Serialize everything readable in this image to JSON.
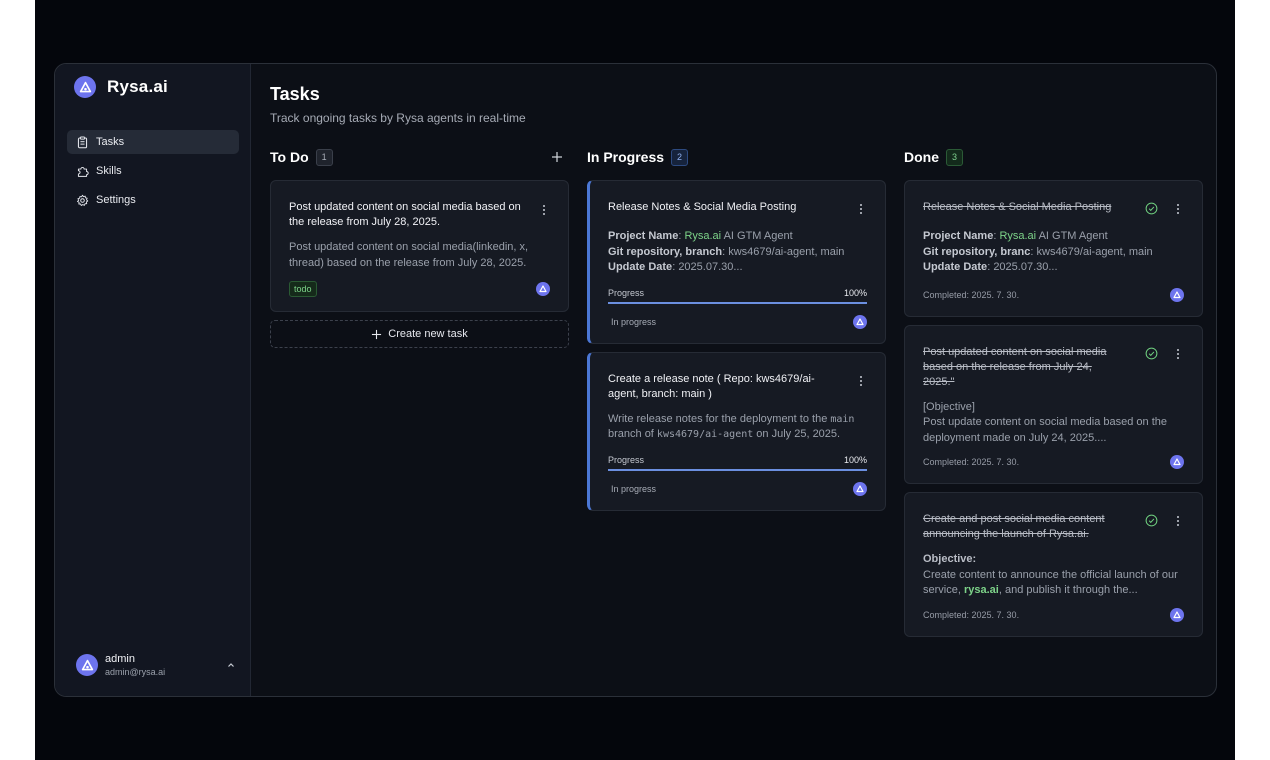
{
  "app": {
    "brand": "Rysa.ai",
    "accent": "#6d74ee"
  },
  "sidebar": {
    "items": [
      {
        "label": "Tasks",
        "icon": "clipboard-icon",
        "active": true
      },
      {
        "label": "Skills",
        "icon": "puzzle-icon",
        "active": false
      },
      {
        "label": "Settings",
        "icon": "gear-icon",
        "active": false
      }
    ],
    "user": {
      "name": "admin",
      "email": "admin@rysa.ai"
    }
  },
  "header": {
    "title": "Tasks",
    "subtitle": "Track ongoing tasks by Rysa agents in real-time"
  },
  "columns": {
    "todo": {
      "title": "To Do",
      "count": "1",
      "create_label": "Create new task",
      "cards": [
        {
          "title": "Post updated content on social media based on the release from July 28, 2025.",
          "desc": "Post updated content on social media(linkedin, x, thread) based on the release from July 28, 2025.",
          "tag": "todo"
        }
      ]
    },
    "progress": {
      "title": "In Progress",
      "count": "2",
      "cards": [
        {
          "title": "Release Notes & Social Media Posting",
          "project_label": "Project Name",
          "project_value_green": "Rysa.ai",
          "project_value_rest": " AI GTM Agent",
          "repo_label": "Git repository, branch",
          "repo_value": "kws4679/ai-agent, main",
          "date_label": "Update Date",
          "date_value": "2025.07.30...",
          "progress_label": "Progress",
          "progress_pct": "100%",
          "progress_value": 1.0,
          "status": "In progress"
        },
        {
          "title": "Create a release note ( Repo: kws4679/ai-agent, branch: main )",
          "desc_a": "Write release notes for the deployment to the ",
          "desc_code1": "main",
          "desc_b": " branch of ",
          "desc_code2": "kws4679/ai-agent",
          "desc_c": " on July 25, 2025.",
          "progress_label": "Progress",
          "progress_pct": "100%",
          "progress_value": 1.0,
          "status": "In progress"
        }
      ]
    },
    "done": {
      "title": "Done",
      "count": "3",
      "cards": [
        {
          "title": "Release Notes & Social Media Posting",
          "project_label": "Project Name",
          "project_value_green": "Rysa.ai",
          "project_value_rest": " AI GTM Agent",
          "repo_label": "Git repository, branc",
          "repo_value": "kws4679/ai-agent, main",
          "date_label": "Update Date",
          "date_value": "2025.07.30...",
          "completed": "Completed: 2025. 7. 30."
        },
        {
          "title": "Post updated content on social media based on the release from July 24, 2025.\"",
          "line1": "[Objective]",
          "line2": "Post update content on social media based on the deployment made on July 24, 2025....",
          "completed": "Completed: 2025. 7. 30."
        },
        {
          "title": "Create and post social media content announcing the launch of Rysa.ai.",
          "objective_label": "Objective:",
          "desc_a": "Create content to announce the official launch of our service, ",
          "desc_green": "rysa.ai",
          "desc_b": ", and publish it through the...",
          "completed": "Completed: 2025. 7. 30."
        }
      ]
    }
  }
}
